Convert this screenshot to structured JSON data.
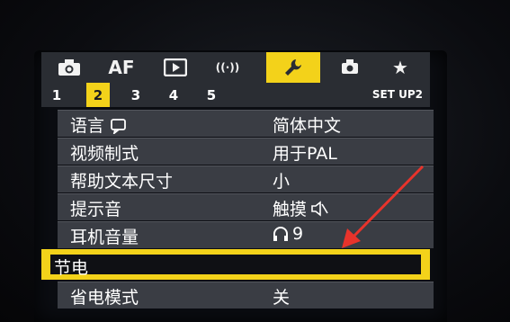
{
  "tabs": [
    {
      "name": "shooting-menu-tab",
      "icon": "camera-icon",
      "label": ""
    },
    {
      "name": "af-menu-tab",
      "icon": "",
      "label": "AF"
    },
    {
      "name": "playback-menu-tab",
      "icon": "play-icon",
      "label": ""
    },
    {
      "name": "wireless-menu-tab",
      "icon": "wireless-icon",
      "label": "((·))"
    },
    {
      "name": "setup-menu-tab",
      "icon": "wrench-icon",
      "label": ""
    },
    {
      "name": "custom-menu-tab",
      "icon": "custom-camera-icon",
      "label": ""
    },
    {
      "name": "my-menu-tab",
      "icon": "star-icon",
      "label": "★"
    }
  ],
  "pages": [
    "1",
    "2",
    "3",
    "4",
    "5"
  ],
  "active_page": "2",
  "page_group_label": "SET UP2",
  "menu_items": [
    {
      "label": "语言",
      "value": "简体中文"
    },
    {
      "label": "视频制式",
      "value": "用于PAL"
    },
    {
      "label": "帮助文本尺寸",
      "value": "小"
    },
    {
      "label": "提示音",
      "value": "触摸"
    },
    {
      "label": "耳机音量",
      "value": "9"
    },
    {
      "label": "节电",
      "value": ""
    },
    {
      "label": "省电模式",
      "value": "关"
    }
  ],
  "selected_item": "节电",
  "colors": {
    "accent": "#f3d21a",
    "row_bg": "#3a3d44",
    "tabbar_bg": "#2a2d33",
    "annotation_arrow": "#e8332b"
  }
}
